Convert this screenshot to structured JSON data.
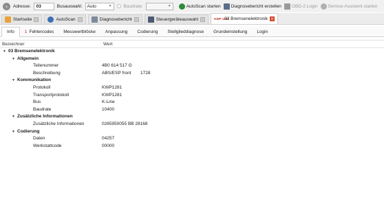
{
  "toolbar": {
    "address_label": "Adresse:",
    "address_value": "03",
    "bus_label": "Busauswahl:",
    "bus_value": "Auto",
    "baud_label": "Baudrate:",
    "baud_value": "",
    "autoscan_start": "AutoScan starten",
    "diagnostic_report": "Diagnosebericht erstellen",
    "obd_login": "OBD-2 Login",
    "service_assistant": "Service-Assistent starten"
  },
  "doc_tabs": [
    {
      "label": "Startseite"
    },
    {
      "label": "AutoScan"
    },
    {
      "label": "Diagnosebericht"
    },
    {
      "label": "Steuergeräteauswahl"
    },
    {
      "label": "03 Bremsenelektronik",
      "prefix": "KWP 1281"
    }
  ],
  "sub_tabs": {
    "info": "Info",
    "error_count": "1",
    "errors": "Fehlercodes",
    "measure": "Messwertblöcke",
    "adapt": "Anpassung",
    "coding": "Codierung",
    "actuator": "Stellglieddiagnose",
    "basic": "Grundeinstellung",
    "login": "Login"
  },
  "table": {
    "col_name": "Bezeichner",
    "col_value": "Wert",
    "root": "03 Bremsenelektronik",
    "general": "Allgemein",
    "part_no_label": "Teilenummer",
    "part_no": "4B0 614 517 G",
    "desc_label": "Beschreibung",
    "desc_value": "ABS/ESP front",
    "desc_code": "1728",
    "comm": "Kommunikation",
    "protocol_label": "Protokoll",
    "protocol": "KWP1281",
    "transport_label": "Transportprotokoll",
    "transport": "KWP1281",
    "bus_label": "Bus",
    "bus": "K-Line",
    "baud_label": "Baudrate",
    "baud": "10400",
    "extra": "Zusätzliche Informationen",
    "extra_label": "Zusätzliche Informationen",
    "extra_value": "0265950055  BB 28168",
    "coding": "Codierung",
    "data_label": "Daten",
    "data_value": "04257",
    "workshop_label": "Werkstattcode",
    "workshop_value": "00000"
  }
}
